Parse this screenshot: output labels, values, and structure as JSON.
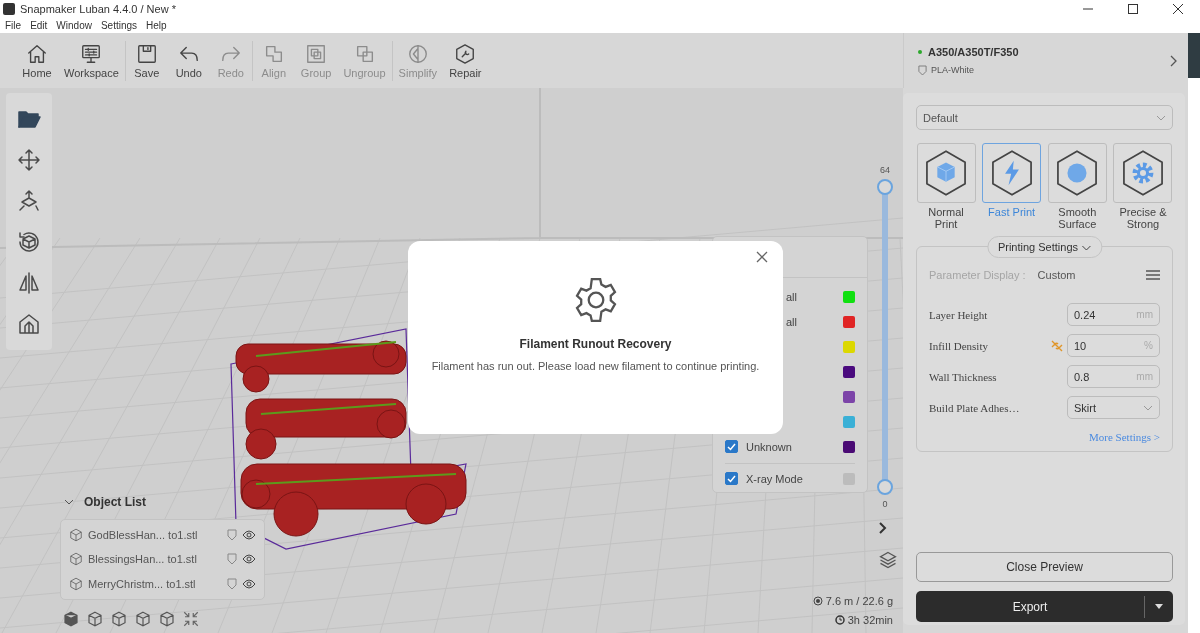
{
  "window": {
    "title": "Snapmaker Luban 4.4.0 / New *"
  },
  "menu": [
    "File",
    "Edit",
    "Window",
    "Settings",
    "Help"
  ],
  "toolbar_groups": [
    [
      {
        "label": "Home",
        "kind": "home",
        "disabled": false
      },
      {
        "label": "Workspace",
        "kind": "workspace",
        "disabled": false
      }
    ],
    [
      {
        "label": "Save",
        "kind": "save",
        "disabled": false
      },
      {
        "label": "Undo",
        "kind": "undo",
        "disabled": false
      },
      {
        "label": "Redo",
        "kind": "redo",
        "disabled": true
      }
    ],
    [
      {
        "label": "Align",
        "kind": "align",
        "disabled": true
      },
      {
        "label": "Group",
        "kind": "group",
        "disabled": true
      },
      {
        "label": "Ungroup",
        "kind": "ungroup",
        "disabled": true
      }
    ],
    [
      {
        "label": "Simplify",
        "kind": "simplify",
        "disabled": true
      },
      {
        "label": "Repair",
        "kind": "repair",
        "disabled": false
      }
    ]
  ],
  "machine": {
    "name": "A350/A350T/F350",
    "material": "PLA-White"
  },
  "tools": [
    {
      "kind": "open"
    },
    {
      "kind": "move"
    },
    {
      "kind": "scale"
    },
    {
      "kind": "rotate"
    },
    {
      "kind": "mirror"
    },
    {
      "kind": "support"
    }
  ],
  "object_list": {
    "title": "Object List",
    "items": [
      {
        "name": "GodBlessHan... to1.stl"
      },
      {
        "name": "BlessingsHan... to1.stl"
      },
      {
        "name": "MerryChristm... to1.stl"
      }
    ]
  },
  "legend": {
    "rows": [
      {
        "label": "all",
        "color": "#10e010"
      },
      {
        "label": "all",
        "color": "#e02424"
      },
      {
        "color": "#dcd800"
      },
      {
        "color": "#4a0a7e"
      },
      {
        "color": "#7c44a8"
      },
      {
        "color": "#3ab0d6"
      },
      {
        "label": "Unknown",
        "checked": true,
        "color": "#4a0a74"
      }
    ],
    "xray": {
      "label": "X-ray Mode",
      "checked": true,
      "color": "#bcbcbc"
    }
  },
  "layer_slider": {
    "top_label": "64",
    "bottom_label": "0",
    "level": 1
  },
  "stats": {
    "filament": "7.6 m / 22.6 g",
    "time": "3h 32min"
  },
  "dialog": {
    "title": "Filament Runout Recovery",
    "message": "Filament has run out. Please load new filament to continue printing."
  },
  "profile": {
    "preset": "Default",
    "presets": [
      {
        "label": "Normal Print",
        "kind": "cube",
        "selected": false
      },
      {
        "label": "Fast Print",
        "kind": "bolt",
        "selected": true
      },
      {
        "label": "Smooth Surface",
        "kind": "sphere",
        "selected": false
      },
      {
        "label": "Precise & Strong",
        "kind": "gear",
        "selected": false
      }
    ],
    "settings_button": "Printing Settings",
    "parameter_display": {
      "label": "Parameter Display :",
      "value": "Custom"
    },
    "params": [
      {
        "label": "Layer Height",
        "kind": "number",
        "value": "0.24",
        "unit": "mm"
      },
      {
        "label": "Infill Density",
        "kind": "linked",
        "value": "10",
        "unit": "%"
      },
      {
        "label": "Wall Thickness",
        "kind": "number",
        "value": "0.8",
        "unit": "mm"
      },
      {
        "label": "Build Plate Adhes…",
        "kind": "select",
        "value": "Skirt"
      }
    ],
    "more_settings": "More Settings >"
  },
  "buttons": {
    "close_preview": "Close Preview",
    "export": "Export"
  }
}
